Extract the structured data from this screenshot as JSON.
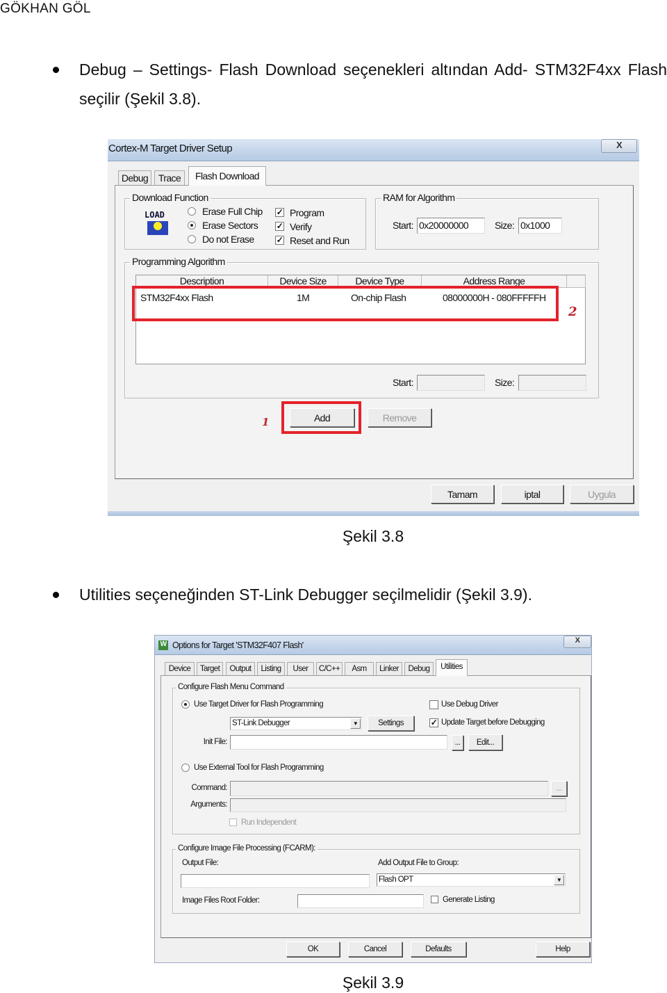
{
  "header": {
    "author": "GÖKHAN GÖL"
  },
  "paragraphs": [
    {
      "line1": "Debug – Settings- Flash Download seçenekleri altından Add- STM32F4xx Flash",
      "line2": "seçilir (Şekil 3.8)."
    },
    {
      "line1": "Utilities seçeneğinden ST-Link Debugger seçilmelidir (Şekil 3.9)."
    }
  ],
  "figure1": {
    "caption": "Şekil 3.8",
    "title": "Cortex-M Target Driver Setup",
    "close": "X",
    "tabs": [
      "Debug",
      "Trace",
      "Flash Download"
    ],
    "selected_tab": "Flash Download",
    "download_function": {
      "label": "Download Function",
      "icon_text": "LOAD",
      "radios": [
        "Erase Full Chip",
        "Erase Sectors",
        "Do not Erase"
      ],
      "selected": "Erase Sectors",
      "checks": [
        {
          "label": "Program",
          "checked": true
        },
        {
          "label": "Verify",
          "checked": true
        },
        {
          "label": "Reset and Run",
          "checked": true
        }
      ]
    },
    "ram": {
      "label": "RAM for Algorithm",
      "start_label": "Start:",
      "start": "0x20000000",
      "size_label": "Size:",
      "size": "0x1000"
    },
    "algorithm": {
      "label": "Programming Algorithm",
      "columns": [
        "Description",
        "Device Size",
        "Device Type",
        "Address Range"
      ],
      "rows": [
        [
          "STM32F4xx Flash",
          "1M",
          "On-chip Flash",
          "08000000H - 080FFFFFH"
        ]
      ],
      "start_label": "Start:",
      "size_label": "Size:",
      "start": "",
      "size": ""
    },
    "add": "Add",
    "remove": "Remove",
    "annotations": [
      "1",
      "2"
    ],
    "annotation_color": "#e3232b",
    "ok": "Tamam",
    "cancel": "iptal",
    "apply": "Uygula"
  },
  "figure2": {
    "caption": "Şekil 3.9",
    "title": "Options for Target 'STM32F407 Flash'",
    "close": "X",
    "tabs": [
      "Device",
      "Target",
      "Output",
      "Listing",
      "User",
      "C/C++",
      "Asm",
      "Linker",
      "Debug",
      "Utilities"
    ],
    "selected_tab": "Utilities",
    "flash_group": {
      "label": "Configure Flash Menu Command",
      "use_target_driver": "Use Target Driver for Flash Programming",
      "use_target_driver_selected": true,
      "driver": "ST-Link Debugger",
      "settings": "Settings",
      "use_debug_driver": "Use Debug Driver",
      "use_debug_driver_checked": false,
      "update_target": "Update Target before Debugging",
      "update_target_checked": true,
      "init_file_label": "Init File:",
      "init_file": "",
      "browse": "...",
      "edit": "Edit...",
      "use_external": "Use External Tool for Flash Programming",
      "command_label": "Command:",
      "command": "",
      "arguments_label": "Arguments:",
      "arguments": "",
      "run_independent": "Run Independent"
    },
    "image_group": {
      "label": "Configure Image File Processing (FCARM):",
      "output_file_label": "Output File:",
      "output_file": "",
      "add_to_group_label": "Add Output File  to Group:",
      "group": "Flash OPT",
      "root_folder_label": "Image Files Root Folder:",
      "root_folder": "",
      "generate_listing": "Generate Listing",
      "generate_listing_checked": false
    },
    "ok": "OK",
    "cancel": "Cancel",
    "defaults": "Defaults",
    "help": "Help"
  }
}
